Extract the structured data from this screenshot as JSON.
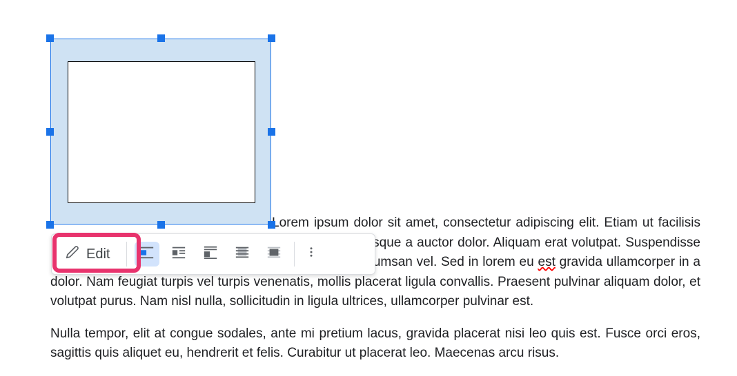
{
  "toolbar": {
    "edit_label": "Edit"
  },
  "icons": {
    "edit": "pencil-icon",
    "inline": "inline-wrap-icon",
    "wrap": "wrap-text-icon",
    "break": "break-text-icon",
    "behind": "behind-text-icon",
    "front": "front-text-icon",
    "more": "more-options-icon"
  },
  "document": {
    "paragraph1_pre": "Lorem ipsum dolor sit amet, consectetur adipiscing elit. Etiam ut facilisis nibh, quis pharetra mauris. Morbi at dictum finibus. Quisque a auctor dolor. Aliquam erat volutpat. Suspendisse potenti. Cras eget faucibus nunc, in bibendum arcu accumsan vel. Sed in lorem eu ",
    "paragraph1_err": "est",
    "paragraph1_post": " gravida ullamcorper in a dolor. Nam feugiat turpis vel turpis venenatis, mollis placerat ligula convallis. Praesent pulvinar aliquam dolor, et volutpat purus. Nam nisl nulla, sollicitudin in ligula ultrices, ullamcorper pulvinar est.",
    "paragraph2": "Nulla tempor, elit at congue sodales, ante mi pretium lacus, gravida placerat nisi leo quis est. Fusce orci eros, sagittis quis aliquet eu, hendrerit et felis. Curabitur ut placerat leo. Maecenas arcu risus."
  }
}
